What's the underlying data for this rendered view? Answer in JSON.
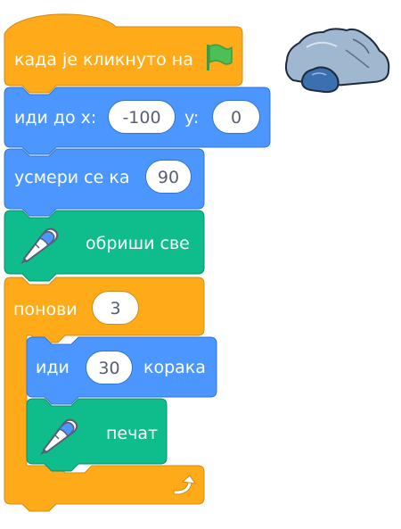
{
  "colors": {
    "events": "#ffab19",
    "events_edge": "#cf8b17",
    "motion": "#4c97ff",
    "motion_edge": "#3373cc",
    "pen": "#0fbd8c",
    "pen_edge": "#0b8e69",
    "control": "#ffab19",
    "control_edge": "#cf8b17"
  },
  "script": {
    "when_flag": {
      "label": "када је кликнуто на",
      "icon": "green-flag-icon"
    },
    "go_to": {
      "label": "иди до x:",
      "x_value": "-100",
      "y_label": "y:",
      "y_value": "0"
    },
    "point": {
      "label": "усмери се ка",
      "value": "90"
    },
    "clear": {
      "label": "обриши све",
      "icon": "pen-icon"
    },
    "repeat": {
      "label": "понови",
      "value": "3",
      "end_icon": "loop-arrow-icon"
    },
    "move": {
      "label": "иди",
      "value": "30",
      "suffix": "корака"
    },
    "stamp": {
      "label": "печат",
      "icon": "pen-icon"
    }
  },
  "sprite": {
    "icon": "rock-sprite-icon"
  }
}
